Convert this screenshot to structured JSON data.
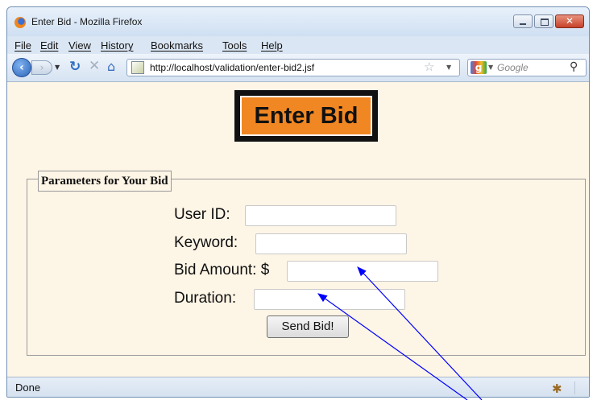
{
  "window": {
    "title": "Enter Bid - Mozilla Firefox"
  },
  "menu": [
    "File",
    "Edit",
    "View",
    "History",
    "Bookmarks",
    "Tools",
    "Help"
  ],
  "navigation": {
    "url": "http://localhost/validation/enter-bid2.jsf",
    "search_placeholder": "Google"
  },
  "page": {
    "heading": "Enter Bid",
    "fieldset_legend": "Parameters for Your Bid",
    "fields": [
      {
        "label": "User ID:",
        "value": ""
      },
      {
        "label": "Keyword:",
        "value": ""
      },
      {
        "label": "Bid Amount: $",
        "value": ""
      },
      {
        "label": "Duration:",
        "value": ""
      }
    ],
    "submit_label": "Send Bid!"
  },
  "status": {
    "text": "Done"
  },
  "colors": {
    "heading_bg": "#f18722",
    "page_bg": "#fdf5e6",
    "annotation_arrows": "#0000ff"
  }
}
